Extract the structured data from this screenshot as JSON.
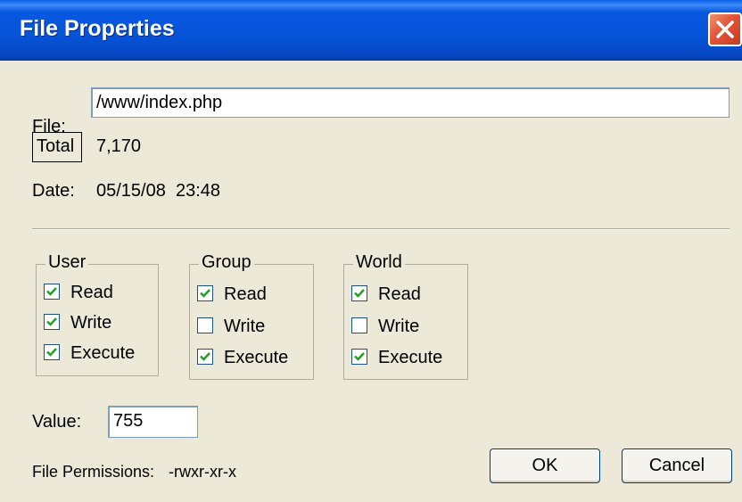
{
  "window": {
    "title": "File Properties",
    "accent": "#0653d8",
    "close_color": "#e0543a"
  },
  "file": {
    "label": "File:",
    "value": "/www/index.php"
  },
  "total": {
    "label": "Total",
    "value": "7,170"
  },
  "date": {
    "label": "Date:",
    "value": "05/15/08  23:48"
  },
  "groups": [
    {
      "label": "User",
      "options": [
        {
          "label": "Read",
          "checked": true
        },
        {
          "label": "Write",
          "checked": true
        },
        {
          "label": "Execute",
          "checked": true
        }
      ]
    },
    {
      "label": "Group",
      "options": [
        {
          "label": "Read",
          "checked": true
        },
        {
          "label": "Write",
          "checked": false
        },
        {
          "label": "Execute",
          "checked": true
        }
      ]
    },
    {
      "label": "World",
      "options": [
        {
          "label": "Read",
          "checked": true
        },
        {
          "label": "Write",
          "checked": false
        },
        {
          "label": "Execute",
          "checked": true
        }
      ]
    }
  ],
  "value_field": {
    "label": "Value:",
    "value": "755"
  },
  "permissions": {
    "label": "File Permissions:",
    "value": "-rwxr-xr-x"
  },
  "buttons": {
    "ok": "OK",
    "cancel": "Cancel"
  }
}
